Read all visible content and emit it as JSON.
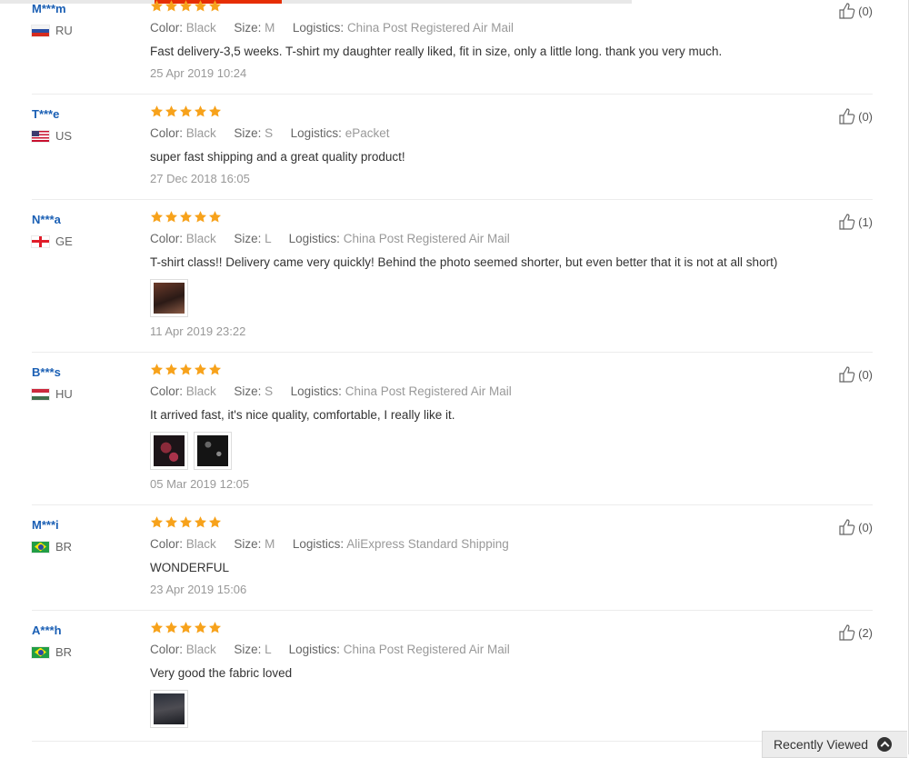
{
  "labels": {
    "color": "Color:",
    "size": "Size:",
    "logistics": "Logistics:"
  },
  "colors": {
    "user_link": "#1a5fb4",
    "star": "#f7a21b",
    "accent": "#e62e04"
  },
  "reviews": [
    {
      "user": "M***m",
      "country": "RU",
      "flag": "ru",
      "color": "Black",
      "size": "M",
      "logistics": "China Post Registered Air Mail",
      "comment": "Fast delivery-3,5 weeks. T-shirt my daughter really liked, fit in size, only a little long. thank you very much.",
      "date": "25 Apr 2019 10:24",
      "helpful": "(0)",
      "photos": []
    },
    {
      "user": "T***e",
      "country": "US",
      "flag": "us",
      "color": "Black",
      "size": "S",
      "logistics": "ePacket",
      "comment": "super fast shipping and a great quality product!",
      "date": "27 Dec 2018 16:05",
      "helpful": "(0)",
      "photos": []
    },
    {
      "user": "N***a",
      "country": "GE",
      "flag": "ge",
      "color": "Black",
      "size": "L",
      "logistics": "China Post Registered Air Mail",
      "comment": "T-shirt class!! Delivery came very quickly! Behind the photo seemed shorter, but even better that it is not at all short)",
      "date": "11 Apr 2019 23:22",
      "helpful": "(1)",
      "photos": [
        "brown"
      ]
    },
    {
      "user": "B***s",
      "country": "HU",
      "flag": "hu",
      "color": "Black",
      "size": "S",
      "logistics": "China Post Registered Air Mail",
      "comment": "It arrived fast, it's nice quality, comfortable, I really like it.",
      "date": "05 Mar 2019 12:05",
      "helpful": "(0)",
      "photos": [
        "dark-red",
        "black"
      ]
    },
    {
      "user": "M***i",
      "country": "BR",
      "flag": "br",
      "color": "Black",
      "size": "M",
      "logistics": "AliExpress Standard Shipping",
      "comment": "WONDERFUL",
      "date": "23 Apr 2019 15:06",
      "helpful": "(0)",
      "photos": []
    },
    {
      "user": "A***h",
      "country": "BR",
      "flag": "br",
      "color": "Black",
      "size": "L",
      "logistics": "China Post Registered Air Mail",
      "comment": "Very good the fabric loved",
      "date": "",
      "helpful": "(2)",
      "photos": [
        "dark"
      ]
    }
  ],
  "recently_viewed": {
    "label": "Recently Viewed",
    "icon": "chevron-up-icon"
  }
}
